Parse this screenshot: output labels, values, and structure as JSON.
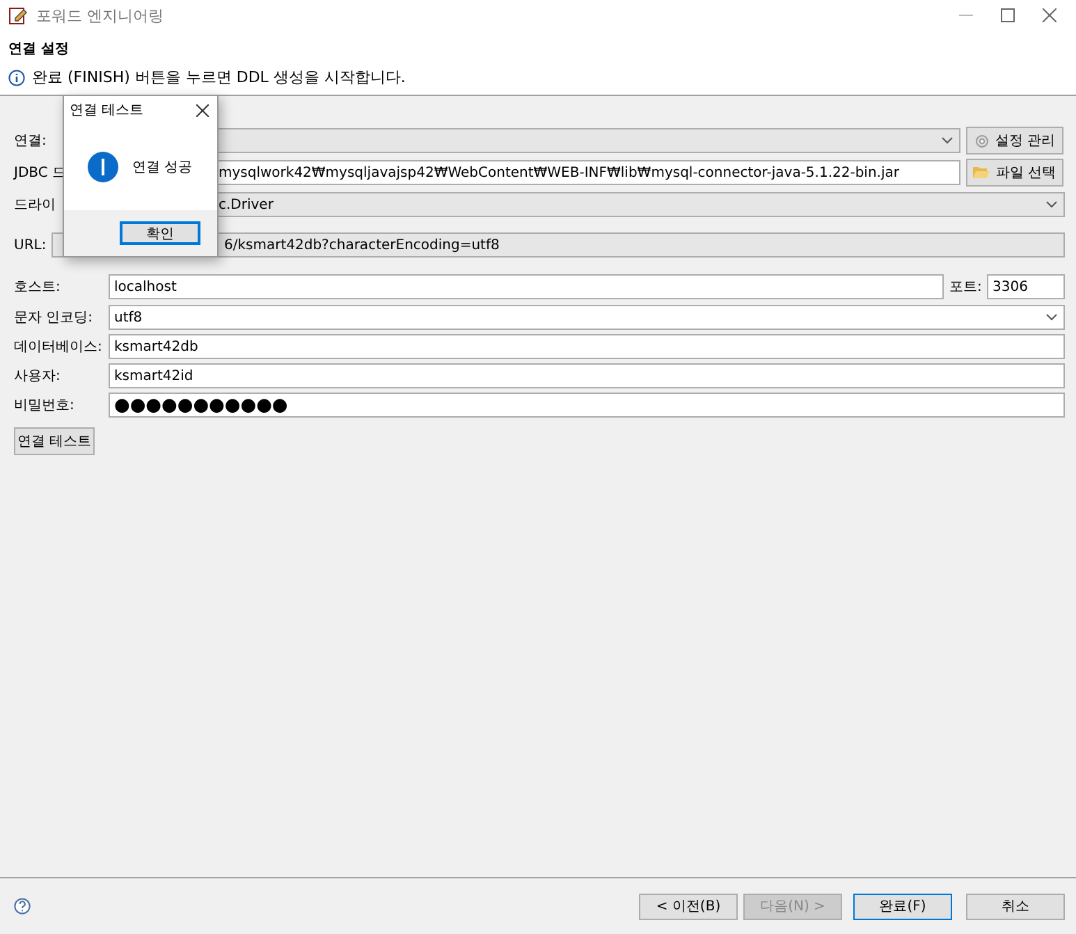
{
  "window": {
    "title": "포워드 엔지니어링"
  },
  "header": {
    "title": "연결 설정",
    "message": "완료 (FINISH) 버튼을 누르면 DDL 생성을 시작합니다."
  },
  "form": {
    "connection": {
      "label": "연결:",
      "button": "설정 관리"
    },
    "jdbc": {
      "label": "JDBC 드",
      "value": "mysqlwork42₩mysqljavajsp42₩WebContent₩WEB-INF₩lib₩mysql-connector-java-5.1.22-bin.jar",
      "button": "파일 선택"
    },
    "driver": {
      "label": "드라이",
      "value": "c.Driver"
    },
    "url": {
      "label": "URL:",
      "value": "6/ksmart42db?characterEncoding=utf8"
    },
    "host": {
      "label": "호스트:",
      "value": "localhost",
      "port_label": "포트:",
      "port": "3306"
    },
    "fields": [
      {
        "kind": "combo",
        "label": "문자 인코딩:",
        "value": "utf8"
      },
      {
        "kind": "text",
        "label": "데이터베이스:",
        "value": "ksmart42db"
      },
      {
        "kind": "text",
        "label": "사용자:",
        "value": "ksmart42id"
      },
      {
        "kind": "password",
        "label": "비밀번호:",
        "value": "●●●●●●●●●●●"
      }
    ],
    "test_button": "연결 테스트"
  },
  "dialog": {
    "title": "연결 테스트",
    "message": "연결 성공",
    "button": "확인"
  },
  "footer": {
    "buttons": [
      {
        "label": "< 이전(B)",
        "disabled": false,
        "default": false
      },
      {
        "label": "다음(N) >",
        "disabled": true,
        "default": false
      },
      {
        "label": "완료(F)",
        "disabled": false,
        "default": true
      },
      {
        "label": "취소",
        "disabled": false,
        "default": false
      }
    ]
  }
}
